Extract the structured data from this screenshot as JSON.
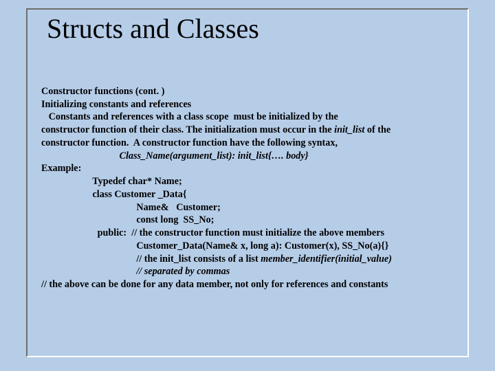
{
  "title": "Structs and Classes",
  "lines": {
    "l0": "Constructor functions (cont. )",
    "l1": "Initializing constants and references",
    "l2": "   Constants and references with a class scope  must be initialized by the",
    "l3_a": "constructor function of their class. The initialization must occur in the ",
    "l3_b": "init_list",
    "l3_c": " of the",
    "l4": "constructor function.  A constructor function have the following syntax,",
    "l5": "                                Class_Name(argument_list): init_list{…. body}",
    "l6": "Example:",
    "l7": "                     Typedef char* Name;",
    "l8": "                     class Customer _Data{",
    "l9": "                                       Name&   Customer;",
    "l10": "                                       const long  SS_No;",
    "l11": "                       public:  // the constructor function must initialize the above members",
    "l12": "                                       Customer_Data(Name& x, long a): Customer(x), SS_No(a){}",
    "l13_a": "                                       // the init_list consists of a list ",
    "l13_b": "member_identifier(initial_value)",
    "l14": "                                       // separated by commas",
    "l15": "// the above can be done for any data member, not only for references and constants"
  }
}
